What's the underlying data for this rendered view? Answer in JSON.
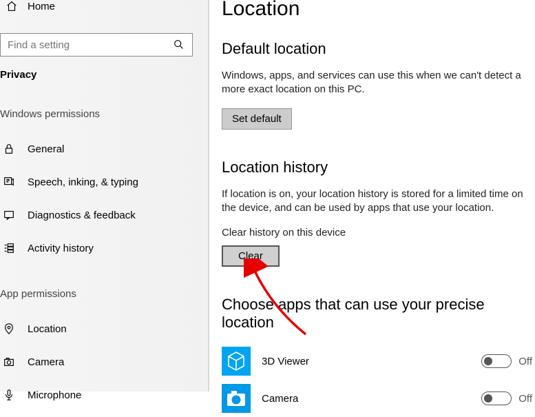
{
  "sidebar": {
    "home": "Home",
    "search_placeholder": "Find a setting",
    "category_label": "Privacy",
    "groups": {
      "windows_permissions": {
        "label": "Windows permissions",
        "items": [
          {
            "label": "General"
          },
          {
            "label": "Speech, inking, & typing"
          },
          {
            "label": "Diagnostics & feedback"
          },
          {
            "label": "Activity history"
          }
        ]
      },
      "app_permissions": {
        "label": "App permissions",
        "items": [
          {
            "label": "Location"
          },
          {
            "label": "Camera"
          },
          {
            "label": "Microphone"
          }
        ]
      }
    }
  },
  "content": {
    "title": "Location",
    "default_location": {
      "heading": "Default location",
      "body": "Windows, apps, and services can use this when we can't detect a more exact location on this PC.",
      "button": "Set default"
    },
    "history": {
      "heading": "Location history",
      "body": "If location is on, your location history is stored for a limited time on the device, and can be used by apps that use your location.",
      "clear_label": "Clear history on this device",
      "clear_button": "Clear"
    },
    "choose_apps": {
      "heading": "Choose apps that can use your precise location",
      "apps": [
        {
          "name": "3D Viewer",
          "state": "Off"
        },
        {
          "name": "Camera",
          "state": "Off"
        }
      ]
    }
  }
}
